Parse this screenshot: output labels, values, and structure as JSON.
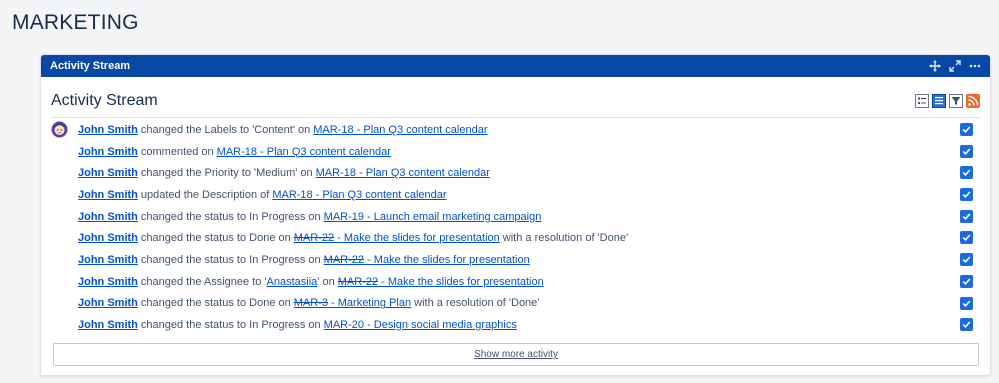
{
  "page": {
    "title": "MARKETING"
  },
  "gadget": {
    "header_title": "Activity Stream"
  },
  "stream": {
    "title": "Activity Stream"
  },
  "activities": [
    {
      "actor": "John Smith",
      "action": "changed the Labels to 'Content' on",
      "issue_key": "MAR-18",
      "issue_summary": " - Plan Q3 content calendar",
      "suffix": ""
    },
    {
      "actor": "John Smith",
      "action": "commented on",
      "issue_key": "MAR-18",
      "issue_summary": " - Plan Q3 content calendar",
      "suffix": ""
    },
    {
      "actor": "John Smith",
      "action": "changed the Priority to 'Medium' on",
      "issue_key": "MAR-18",
      "issue_summary": " - Plan Q3 content calendar",
      "suffix": ""
    },
    {
      "actor": "John Smith",
      "action": "updated the Description of",
      "issue_key": "MAR-18",
      "issue_summary": " - Plan Q3 content calendar",
      "suffix": ""
    },
    {
      "actor": "John Smith",
      "action": "changed the status to In Progress on",
      "issue_key": "MAR-19",
      "issue_summary": " - Launch email marketing campaign",
      "suffix": ""
    },
    {
      "actor": "John Smith",
      "action": "changed the status to Done on",
      "issue_key": "MAR-22",
      "issue_summary": " - Make the slides for presentation",
      "suffix": "with a resolution of 'Done'"
    },
    {
      "actor": "John Smith",
      "action": "changed the status to In Progress on",
      "issue_key": "MAR-22",
      "issue_summary": " - Make the slides for presentation",
      "suffix": ""
    },
    {
      "actor": "John Smith",
      "action": "changed the Assignee to '",
      "assignee": "Anastasiia",
      "action2": "' on",
      "issue_key": "MAR-22",
      "issue_summary": " - Make the slides for presentation",
      "suffix": ""
    },
    {
      "actor": "John Smith",
      "action": "changed the status to Done on",
      "issue_key": "MAR-3",
      "issue_summary": " - Marketing Plan",
      "suffix": "with a resolution of 'Done'"
    },
    {
      "actor": "John Smith",
      "action": "changed the status to In Progress on",
      "issue_key": "MAR-20",
      "issue_summary": " - Design social media graphics",
      "suffix": ""
    }
  ],
  "show_more_label": "Show more activity",
  "icons": {
    "header": [
      "move-icon",
      "expand-icon",
      "more-icon"
    ],
    "views": [
      "list-view-icon",
      "detailed-view-icon",
      "filter-icon",
      "rss-icon"
    ],
    "row": [
      "avatar",
      "checkbox-checked-icon"
    ]
  },
  "colors": {
    "header_bg": "#0747a6",
    "link": "#0052cc",
    "checkbox": "#1a6be0",
    "rss": "#f26522"
  }
}
